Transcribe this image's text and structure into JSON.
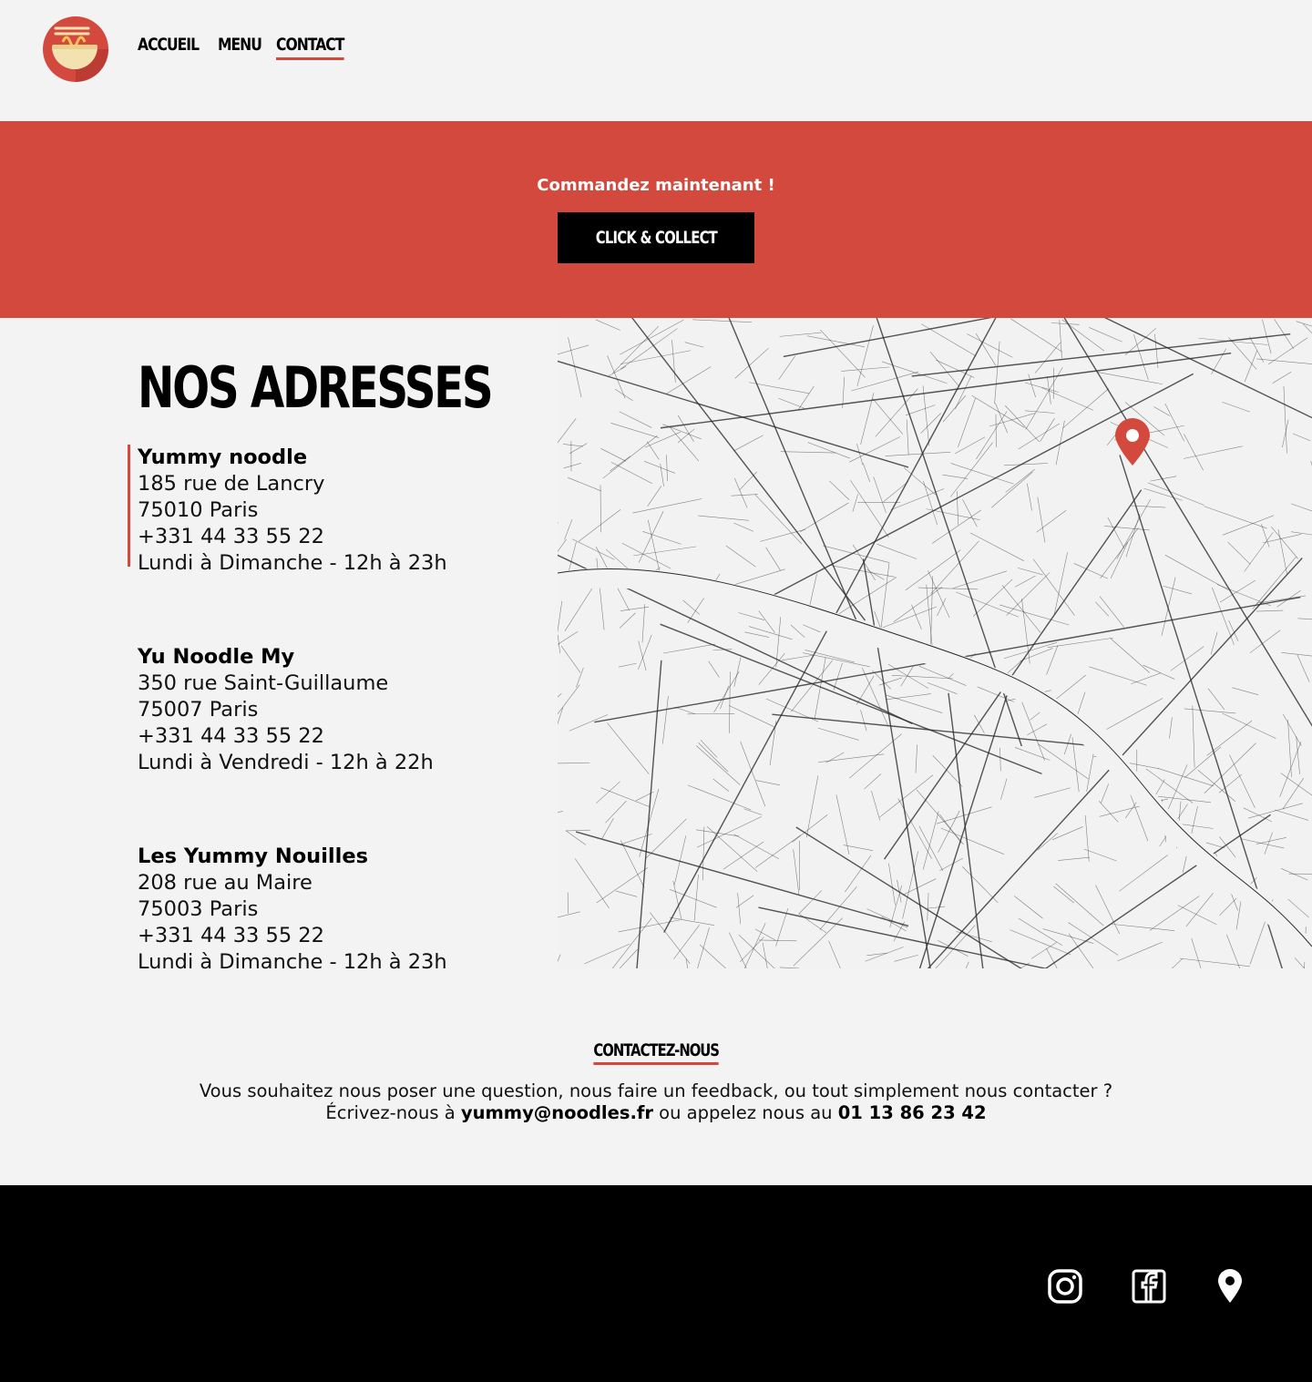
{
  "nav": {
    "items": [
      {
        "label": "ACCUEIL",
        "active": false
      },
      {
        "label": "MENU",
        "active": false
      },
      {
        "label": "CONTACT",
        "active": true
      }
    ]
  },
  "logo": {
    "icon": "noodle-bowl-icon"
  },
  "banner": {
    "text": "Commandez maintenant !",
    "button_label": "CLICK & COLLECT"
  },
  "addresses": {
    "title": "NOS ADRESSES",
    "items": [
      {
        "name": "Yummy noodle",
        "street": "185 rue de Lancry",
        "city": "75010 Paris",
        "phone": "+331 44 33 55 22",
        "hours": "Lundi à Dimanche - 12h à 23h"
      },
      {
        "name": "Yu Noodle My",
        "street": "350 rue Saint-Guillaume",
        "city": "75007 Paris",
        "phone": "+331 44 33 55 22",
        "hours": "Lundi à Vendredi - 12h à 22h"
      },
      {
        "name": "Les Yummy Nouilles",
        "street": "208 rue au Maire",
        "city": "75003 Paris",
        "phone": "+331 44 33 55 22",
        "hours": "Lundi à Dimanche - 12h à 23h"
      }
    ]
  },
  "map": {
    "pin_icon": "map-pin-icon"
  },
  "contact": {
    "title": "CONTACTEZ-NOUS",
    "line1": "Vous souhaitez nous poser une question, nous faire un feedback, ou tout simplement nous contacter ?",
    "line2_prefix": "Écrivez-nous à",
    "email": "yummy@noodles.fr",
    "line2_middle": "ou appelez nous au",
    "phone": "01 13 86 23 42"
  },
  "footer": {
    "icons": [
      "instagram-icon",
      "facebook-icon",
      "location-pin-icon"
    ]
  },
  "colors": {
    "accent": "#d4493e",
    "background": "#f3f3f3",
    "footer": "#000000"
  }
}
